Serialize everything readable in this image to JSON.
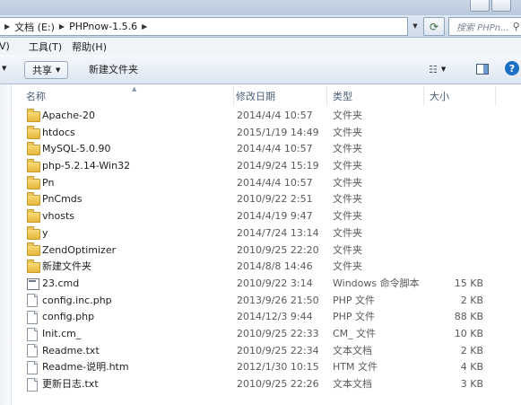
{
  "address": {
    "crumbs": [
      "文档 (E:)",
      "PHPnow-1.5.6"
    ],
    "search_placeholder": "搜索 PHPn..."
  },
  "menu": {
    "partial": "V)",
    "tools": "工具(T)",
    "help": "帮助(H)"
  },
  "toolbar": {
    "share": "共享",
    "new_folder": "新建文件夹"
  },
  "columns": {
    "name": "名称",
    "date": "修改日期",
    "type": "类型",
    "size": "大小"
  },
  "files": [
    {
      "name": "Apache-20",
      "date": "2014/4/4 10:57",
      "type": "文件夹",
      "size": "",
      "icon": "folder-icon"
    },
    {
      "name": "htdocs",
      "date": "2015/1/19 14:49",
      "type": "文件夹",
      "size": "",
      "icon": "folder-icon"
    },
    {
      "name": "MySQL-5.0.90",
      "date": "2014/4/4 10:57",
      "type": "文件夹",
      "size": "",
      "icon": "folder-icon"
    },
    {
      "name": "php-5.2.14-Win32",
      "date": "2014/9/24 15:19",
      "type": "文件夹",
      "size": "",
      "icon": "folder-icon"
    },
    {
      "name": "Pn",
      "date": "2014/4/4 10:57",
      "type": "文件夹",
      "size": "",
      "icon": "folder-icon"
    },
    {
      "name": "PnCmds",
      "date": "2010/9/22 2:51",
      "type": "文件夹",
      "size": "",
      "icon": "folder-icon"
    },
    {
      "name": "vhosts",
      "date": "2014/4/19 9:47",
      "type": "文件夹",
      "size": "",
      "icon": "folder-icon"
    },
    {
      "name": "y",
      "date": "2014/7/24 13:14",
      "type": "文件夹",
      "size": "",
      "icon": "folder-icon"
    },
    {
      "name": "ZendOptimizer",
      "date": "2010/9/25 22:20",
      "type": "文件夹",
      "size": "",
      "icon": "folder-icon"
    },
    {
      "name": "新建文件夹",
      "date": "2014/8/8 14:46",
      "type": "文件夹",
      "size": "",
      "icon": "folder-icon"
    },
    {
      "name": "23.cmd",
      "date": "2010/9/22 3:14",
      "type": "Windows 命令脚本",
      "size": "15 KB",
      "icon": "cmd-file-icon"
    },
    {
      "name": "config.inc.php",
      "date": "2013/9/26 21:50",
      "type": "PHP 文件",
      "size": "2 KB",
      "icon": "file-icon"
    },
    {
      "name": "config.php",
      "date": "2014/12/3 9:44",
      "type": "PHP 文件",
      "size": "88 KB",
      "icon": "file-icon"
    },
    {
      "name": "Init.cm_",
      "date": "2010/9/25 22:33",
      "type": "CM_ 文件",
      "size": "10 KB",
      "icon": "file-icon"
    },
    {
      "name": "Readme.txt",
      "date": "2010/9/25 22:34",
      "type": "文本文档",
      "size": "2 KB",
      "icon": "file-icon"
    },
    {
      "name": "Readme-说明.htm",
      "date": "2012/1/30 10:15",
      "type": "HTM 文件",
      "size": "4 KB",
      "icon": "file-icon"
    },
    {
      "name": "更新日志.txt",
      "date": "2010/9/25 22:26",
      "type": "文本文档",
      "size": "3 KB",
      "icon": "file-icon"
    }
  ]
}
